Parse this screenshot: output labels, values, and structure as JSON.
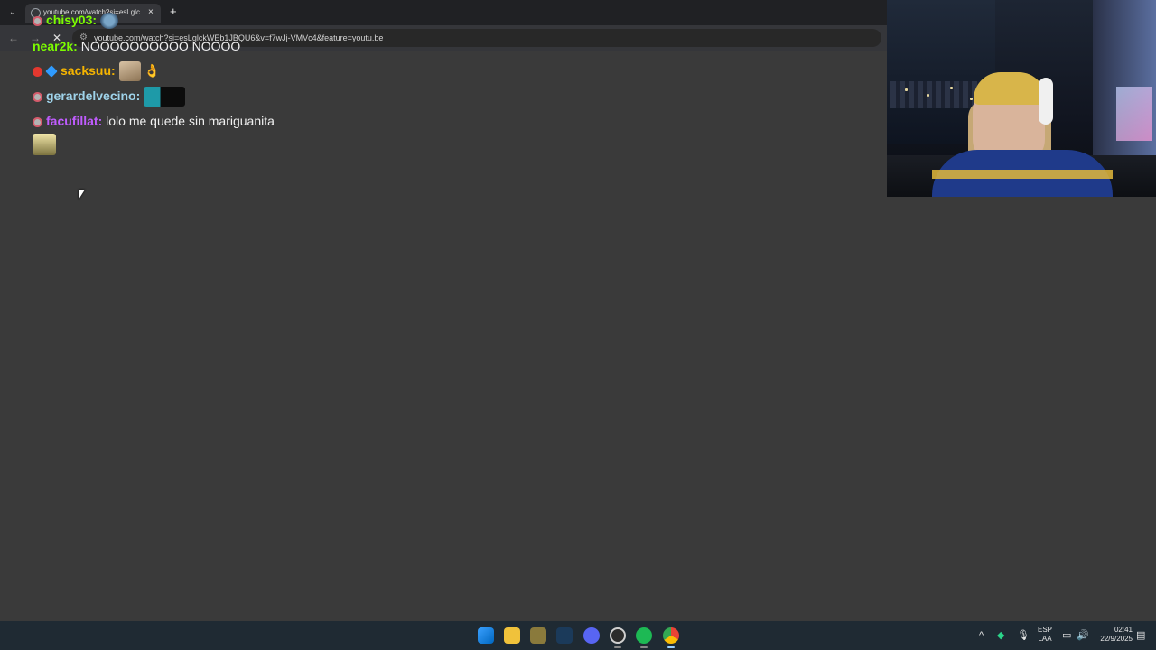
{
  "browser": {
    "tab_title": "youtube.com/watch?si=esLglc",
    "tab_close": "×",
    "new_tab": "+",
    "url": "youtube.com/watch?si=esLglckWEb1JBQU6&v=f7wJj-VMVc4&feature=youtu.be",
    "stop_symbol": "✕"
  },
  "chat": {
    "messages": [
      {
        "user": "chisy03",
        "sep": ":",
        "text": "",
        "user_color": "#7CFC00"
      },
      {
        "user": "near2k",
        "sep": ":",
        "text": "NOOOOOOOOOO NOOOO",
        "user_color": "#7CFC00"
      },
      {
        "user": "sacksuu",
        "sep": ":",
        "text": "👌",
        "user_color": "#f5b400"
      },
      {
        "user": "gerardelvecino",
        "sep": ":",
        "text": "",
        "user_color": "#9fd3ea"
      },
      {
        "user": "facufillat",
        "sep": ":",
        "text": "lolo me quede sin mariguanita",
        "user_color": "#c05cff"
      }
    ]
  },
  "taskbar": {
    "lang_line1": "ESP",
    "lang_line2": "LAA",
    "time": "02:41",
    "date": "22/9/2025",
    "tray_chevron": "^"
  },
  "colors": {
    "page_bg": "#3a3a3a",
    "taskbar_bg": "#1f2a33",
    "chrome_bg": "#202124"
  }
}
